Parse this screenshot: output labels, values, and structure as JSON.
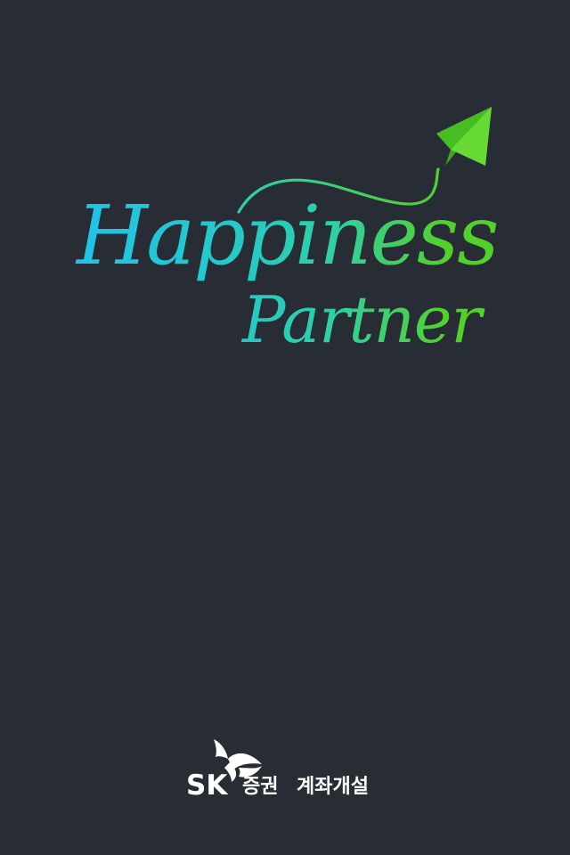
{
  "slogan": {
    "line1": "Happiness",
    "line2": "Partner"
  },
  "footer": {
    "logo_letters": "SK",
    "brand_label": "증권",
    "action_label": "계좌개설"
  },
  "colors": {
    "background": "#272c35",
    "gradient_start": "#1ec3ea",
    "gradient_mid": "#2fd0a4",
    "gradient_end": "#52d12b",
    "plane_light": "#5fd12f",
    "plane_dark": "#3aa81a",
    "logo_text": "#ffffff"
  },
  "icons": {
    "plane": "paper-airplane-icon",
    "brand": "sk-butterfly-logo"
  }
}
